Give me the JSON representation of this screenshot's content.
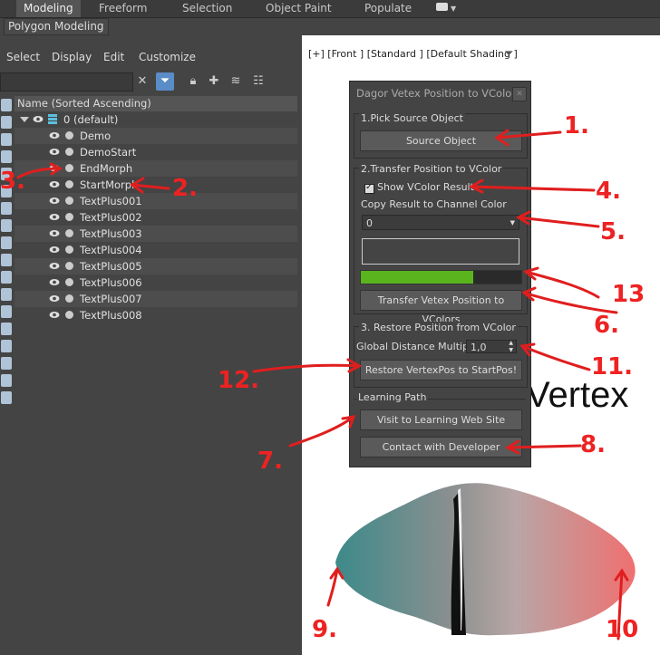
{
  "topbar": {
    "tabs": [
      "Modeling",
      "Freeform",
      "Selection",
      "Object Paint",
      "Populate"
    ],
    "subtab": "Polygon Modeling"
  },
  "explorer": {
    "menu": [
      "Select",
      "Display",
      "Edit",
      "Customize"
    ],
    "header": "Name (Sorted Ascending)",
    "root": "0 (default)",
    "items": [
      "Demo",
      "DemoStart",
      "EndMorph",
      "StartMorph",
      "TextPlus001",
      "TextPlus002",
      "TextPlus003",
      "TextPlus004",
      "TextPlus005",
      "TextPlus006",
      "TextPlus007",
      "TextPlus008"
    ]
  },
  "viewport": {
    "label": "[+] [Front ] [Standard ] [Default Shading ]",
    "text": "Vertex"
  },
  "dialog": {
    "title": "Dagor Vetex Position to VColor",
    "section1": "1.Pick Source Object",
    "source_button": "Source Object",
    "section2": "2.Transfer Position to VColor",
    "show_result": "Show VColor Result",
    "show_result_checked": true,
    "copy_label": "Copy Result to Channel Color",
    "channel_value": "0",
    "progress": 0.7,
    "transfer_button": "Transfer Vetex Position to VColors",
    "section3": "3. Restore Position from VColor",
    "multiplier_label": "Global Distance Multiplier",
    "multiplier_value": "1,0",
    "restore_button": "Restore VertexPos to StartPos!",
    "learning_label": "Learning Path",
    "visit_button": "Visit to Learning Web Site",
    "contact_button": "Contact with Developer"
  },
  "annotations": [
    "1.",
    "2.",
    "3.",
    "4.",
    "5.",
    "6.",
    "7.",
    "8.",
    "9.",
    "10",
    "11.",
    "12.",
    "13"
  ],
  "colors": {
    "annotation": "#e01e1e",
    "progress": "#5ab41e",
    "gradient_left": "#3d8a8a",
    "gradient_right": "#f07070"
  }
}
